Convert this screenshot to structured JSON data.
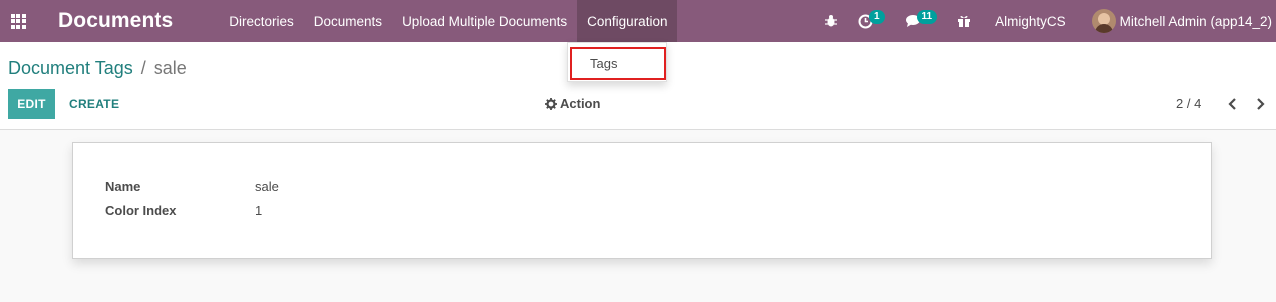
{
  "navbar": {
    "app_title": "Documents",
    "menu": [
      {
        "label": "Directories"
      },
      {
        "label": "Documents"
      },
      {
        "label": "Upload Multiple Documents"
      },
      {
        "label": "Configuration"
      }
    ],
    "activity_count": "1",
    "messages_count": "11",
    "company": "AlmightyCS",
    "user": "Mitchell Admin (app14_2)"
  },
  "dropdown": {
    "items": [
      {
        "label": "Tags"
      }
    ]
  },
  "breadcrumb": {
    "parent": "Document Tags",
    "separator": "/",
    "current": "sale"
  },
  "control": {
    "edit_label": "EDIT",
    "create_label": "CREATE",
    "action_label": "Action",
    "pager": "2 / 4"
  },
  "form": {
    "fields": [
      {
        "label": "Name",
        "value": "sale"
      },
      {
        "label": "Color Index",
        "value": "1"
      }
    ]
  },
  "colors": {
    "navbar": "#875a7b",
    "accent": "#00a09d",
    "highlight_border": "#e02020"
  }
}
